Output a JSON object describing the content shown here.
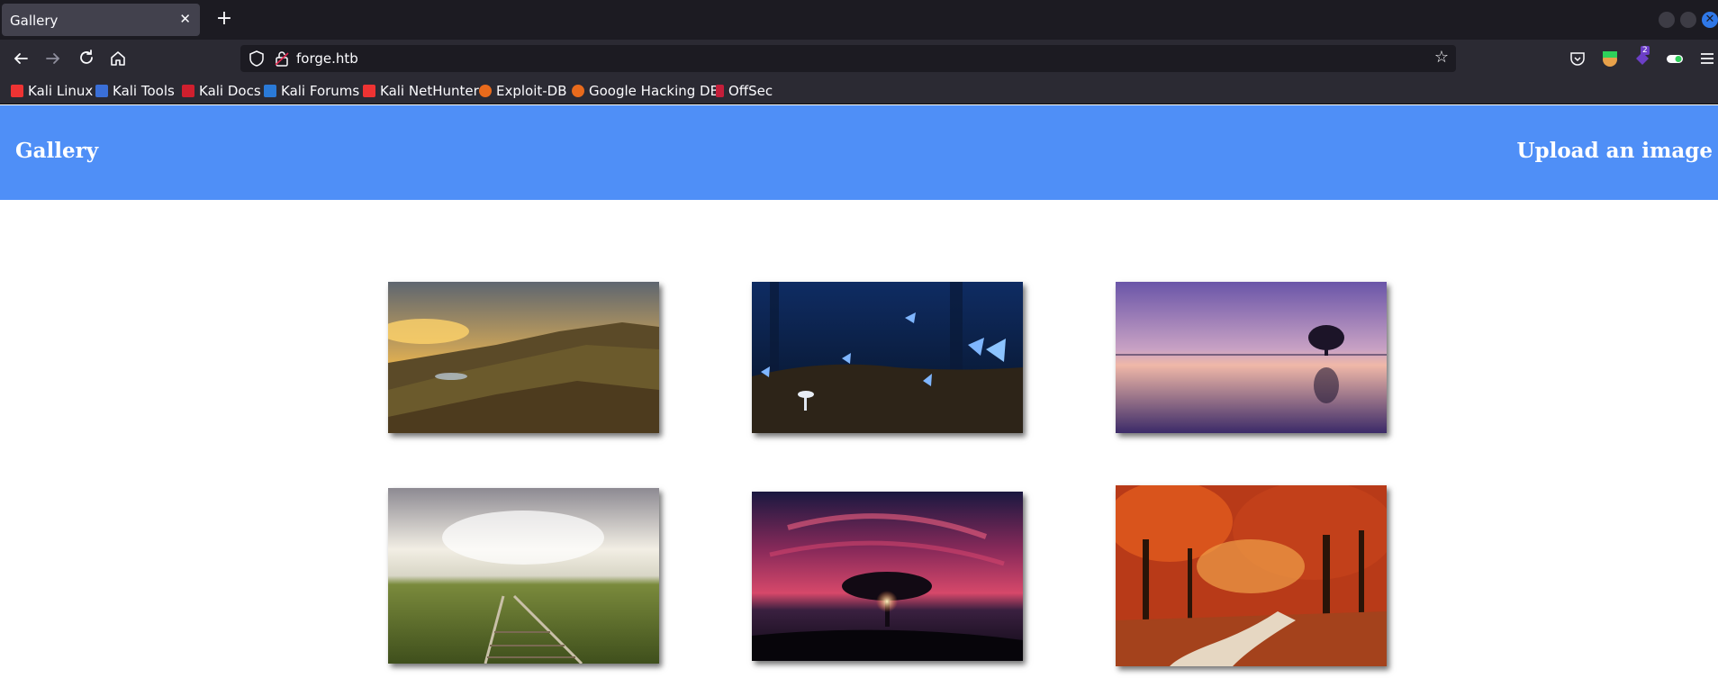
{
  "browser": {
    "tab_title": "Gallery",
    "close_glyph": "✕",
    "newtab_glyph": "+",
    "url": "forge.htb",
    "extension_badge_count": "2"
  },
  "bookmarks": [
    {
      "label": "Kali Linux",
      "icon": "kali-dragon-icon"
    },
    {
      "label": "Kali Tools",
      "icon": "kali-tools-icon"
    },
    {
      "label": "Kali Docs",
      "icon": "kali-docs-icon"
    },
    {
      "label": "Kali Forums",
      "icon": "kali-forums-icon"
    },
    {
      "label": "Kali NetHunter",
      "icon": "kali-nethunter-icon"
    },
    {
      "label": "Exploit-DB",
      "icon": "exploit-db-icon"
    },
    {
      "label": "Google Hacking DB",
      "icon": "ghdb-icon"
    },
    {
      "label": "OffSec",
      "icon": "offsec-icon"
    }
  ],
  "page": {
    "title": "Gallery",
    "upload_link": "Upload an image"
  },
  "gallery": [
    {
      "subject": "mountain landscape at sunset"
    },
    {
      "subject": "blue butterflies and mushrooms"
    },
    {
      "subject": "lone tree on calm lake at dusk"
    },
    {
      "subject": "railway track through grassland"
    },
    {
      "subject": "tree silhouette under red sky"
    },
    {
      "subject": "autumn forest path"
    }
  ],
  "colors": {
    "header_bg": "#4f8ff7",
    "browser_bg": "#1c1b22",
    "toolbar_bg": "#2b2a33"
  }
}
